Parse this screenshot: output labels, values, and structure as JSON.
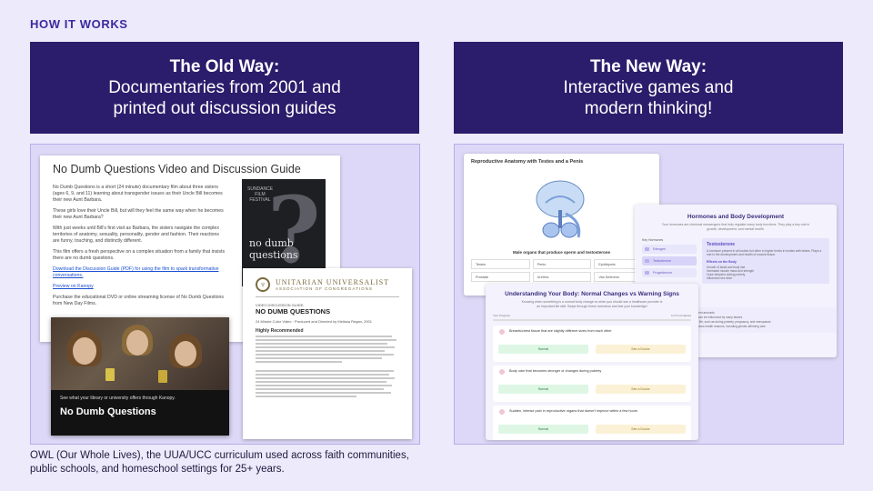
{
  "kicker": "HOW IT WORKS",
  "old": {
    "title": "The Old Way:",
    "line1": "Documentaries from 2001 and",
    "line2": "printed out discussion guides"
  },
  "new": {
    "title": "The New Way:",
    "line1": "Interactive games and",
    "line2": "modern thinking!"
  },
  "caption": "OWL (Our Whole Lives), the UUA/UCC curriculum used across faith communities, public schools, and homeschool settings for 25+ years.",
  "doc1": {
    "title": "No Dumb Questions Video and Discussion Guide",
    "p1": "No Dumb Questions is a short (24 minute) documentary film about three sisters (ages 6, 9, and 11) learning about transgender issues as their Uncle Bill becomes their new Aunt Barbara.",
    "p2": "These girls love their Uncle Bill, but will they feel the same way when he becomes their new Aunt Barbara?",
    "p3": "With just weeks until Bill's first visit as Barbara, the sisters navigate the complex territories of anatomy, sexuality, personality, gender and fashion. Their reactions are funny, touching, and distinctly different.",
    "p4": "This film offers a fresh perspective on a complex situation from a family that insists there are no dumb questions.",
    "link1": "Download the Discussion Guide (PDF) for using the film to spark transformative conversations.",
    "link2": "Preview on Kanopy",
    "p5": "Purchase the educational DVD or online streaming license of No Dumb Questions from New Day Films.",
    "dvd_title": "no dumb questions",
    "dvd_laurel": "SUNDANCE FILM FESTIVAL"
  },
  "doc2": {
    "org1": "UNITARIAN UNIVERSALIST",
    "org2": "ASSOCIATION OF CONGREGATIONS",
    "kicker": "VIDEO DISCUSSION GUIDE:",
    "title": "NO DUMB QUESTIONS",
    "meta": "24 Minute Color Video · Produced and Directed by Melissa Regan, 2001",
    "heading": "Highly Recommended"
  },
  "video": {
    "caption": "See what your library or university offers through Kanopy.",
    "title": "No Dumb Questions"
  },
  "screen1": {
    "title": "Reproductive Anatomy with Testes and a Penis",
    "subtitle": "Male organs that produce sperm and testosterone",
    "cells": [
      "Testes",
      "Penis",
      "Epididymis",
      "Prostate",
      "Urethra",
      "Vas Deferens"
    ]
  },
  "screen2": {
    "title": "Hormones and Body Development",
    "desc": "Your hormones are chemical messengers that help regulate many body functions. They play a key role in growth, development, and mental health.",
    "label": "Key Hormones",
    "items": [
      "Estrogen",
      "Testosterone",
      "Progesterone"
    ],
    "card_title": "Testosterone",
    "card_text": "A hormone present in all bodies but often in higher levels in bodies with testes. Plays a role in the development and health of muscle tissue.",
    "card_where": "Effects on the Body",
    "card_list": [
      "Growth of facial and body hair",
      "Increased muscle mass and strength",
      "Voice deepens during puberty",
      "Influences sex drive"
    ],
    "bottom": [
      "hormones, just in different amounts",
      "en during puberty and can be influenced by many factors",
      "er changes throughout life, such as during puberty, pregnancy, and menopause",
      "dy modifications for various health reasons, including gender-affirming care"
    ]
  },
  "screen3": {
    "title": "Understanding Your Body: Normal Changes vs Warning Signs",
    "desc": "Knowing when something is a normal body change vs when you should see a healthcare provider is an important life skill. Swipe through these scenarios and test your knowledge!",
    "progress_label": "Your Progress",
    "progress_count": "0 of 5 completed",
    "questions": [
      "Breasts/chest tissue that are slightly different sizes from each other",
      "Body odor that becomes stronger or changes during puberty",
      "Sudden, intense pain in reproductive organs that doesn't improve within a few hours"
    ],
    "normal_label": "Normal",
    "doctor_label": "See a Doctor"
  }
}
